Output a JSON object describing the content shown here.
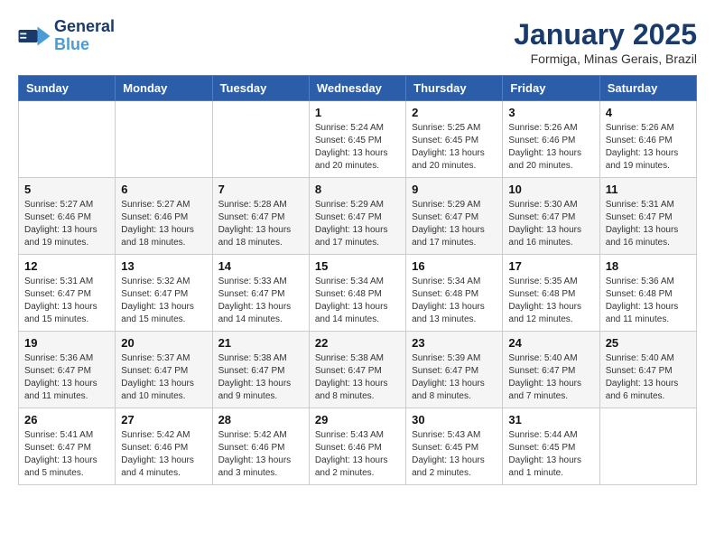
{
  "header": {
    "logo_line1": "General",
    "logo_line2": "Blue",
    "month": "January 2025",
    "location": "Formiga, Minas Gerais, Brazil"
  },
  "weekdays": [
    "Sunday",
    "Monday",
    "Tuesday",
    "Wednesday",
    "Thursday",
    "Friday",
    "Saturday"
  ],
  "weeks": [
    [
      {
        "day": "",
        "info": ""
      },
      {
        "day": "",
        "info": ""
      },
      {
        "day": "",
        "info": ""
      },
      {
        "day": "1",
        "info": "Sunrise: 5:24 AM\nSunset: 6:45 PM\nDaylight: 13 hours\nand 20 minutes."
      },
      {
        "day": "2",
        "info": "Sunrise: 5:25 AM\nSunset: 6:45 PM\nDaylight: 13 hours\nand 20 minutes."
      },
      {
        "day": "3",
        "info": "Sunrise: 5:26 AM\nSunset: 6:46 PM\nDaylight: 13 hours\nand 20 minutes."
      },
      {
        "day": "4",
        "info": "Sunrise: 5:26 AM\nSunset: 6:46 PM\nDaylight: 13 hours\nand 19 minutes."
      }
    ],
    [
      {
        "day": "5",
        "info": "Sunrise: 5:27 AM\nSunset: 6:46 PM\nDaylight: 13 hours\nand 19 minutes."
      },
      {
        "day": "6",
        "info": "Sunrise: 5:27 AM\nSunset: 6:46 PM\nDaylight: 13 hours\nand 18 minutes."
      },
      {
        "day": "7",
        "info": "Sunrise: 5:28 AM\nSunset: 6:47 PM\nDaylight: 13 hours\nand 18 minutes."
      },
      {
        "day": "8",
        "info": "Sunrise: 5:29 AM\nSunset: 6:47 PM\nDaylight: 13 hours\nand 17 minutes."
      },
      {
        "day": "9",
        "info": "Sunrise: 5:29 AM\nSunset: 6:47 PM\nDaylight: 13 hours\nand 17 minutes."
      },
      {
        "day": "10",
        "info": "Sunrise: 5:30 AM\nSunset: 6:47 PM\nDaylight: 13 hours\nand 16 minutes."
      },
      {
        "day": "11",
        "info": "Sunrise: 5:31 AM\nSunset: 6:47 PM\nDaylight: 13 hours\nand 16 minutes."
      }
    ],
    [
      {
        "day": "12",
        "info": "Sunrise: 5:31 AM\nSunset: 6:47 PM\nDaylight: 13 hours\nand 15 minutes."
      },
      {
        "day": "13",
        "info": "Sunrise: 5:32 AM\nSunset: 6:47 PM\nDaylight: 13 hours\nand 15 minutes."
      },
      {
        "day": "14",
        "info": "Sunrise: 5:33 AM\nSunset: 6:47 PM\nDaylight: 13 hours\nand 14 minutes."
      },
      {
        "day": "15",
        "info": "Sunrise: 5:34 AM\nSunset: 6:48 PM\nDaylight: 13 hours\nand 14 minutes."
      },
      {
        "day": "16",
        "info": "Sunrise: 5:34 AM\nSunset: 6:48 PM\nDaylight: 13 hours\nand 13 minutes."
      },
      {
        "day": "17",
        "info": "Sunrise: 5:35 AM\nSunset: 6:48 PM\nDaylight: 13 hours\nand 12 minutes."
      },
      {
        "day": "18",
        "info": "Sunrise: 5:36 AM\nSunset: 6:48 PM\nDaylight: 13 hours\nand 11 minutes."
      }
    ],
    [
      {
        "day": "19",
        "info": "Sunrise: 5:36 AM\nSunset: 6:47 PM\nDaylight: 13 hours\nand 11 minutes."
      },
      {
        "day": "20",
        "info": "Sunrise: 5:37 AM\nSunset: 6:47 PM\nDaylight: 13 hours\nand 10 minutes."
      },
      {
        "day": "21",
        "info": "Sunrise: 5:38 AM\nSunset: 6:47 PM\nDaylight: 13 hours\nand 9 minutes."
      },
      {
        "day": "22",
        "info": "Sunrise: 5:38 AM\nSunset: 6:47 PM\nDaylight: 13 hours\nand 8 minutes."
      },
      {
        "day": "23",
        "info": "Sunrise: 5:39 AM\nSunset: 6:47 PM\nDaylight: 13 hours\nand 8 minutes."
      },
      {
        "day": "24",
        "info": "Sunrise: 5:40 AM\nSunset: 6:47 PM\nDaylight: 13 hours\nand 7 minutes."
      },
      {
        "day": "25",
        "info": "Sunrise: 5:40 AM\nSunset: 6:47 PM\nDaylight: 13 hours\nand 6 minutes."
      }
    ],
    [
      {
        "day": "26",
        "info": "Sunrise: 5:41 AM\nSunset: 6:47 PM\nDaylight: 13 hours\nand 5 minutes."
      },
      {
        "day": "27",
        "info": "Sunrise: 5:42 AM\nSunset: 6:46 PM\nDaylight: 13 hours\nand 4 minutes."
      },
      {
        "day": "28",
        "info": "Sunrise: 5:42 AM\nSunset: 6:46 PM\nDaylight: 13 hours\nand 3 minutes."
      },
      {
        "day": "29",
        "info": "Sunrise: 5:43 AM\nSunset: 6:46 PM\nDaylight: 13 hours\nand 2 minutes."
      },
      {
        "day": "30",
        "info": "Sunrise: 5:43 AM\nSunset: 6:45 PM\nDaylight: 13 hours\nand 2 minutes."
      },
      {
        "day": "31",
        "info": "Sunrise: 5:44 AM\nSunset: 6:45 PM\nDaylight: 13 hours\nand 1 minute."
      },
      {
        "day": "",
        "info": ""
      }
    ]
  ]
}
